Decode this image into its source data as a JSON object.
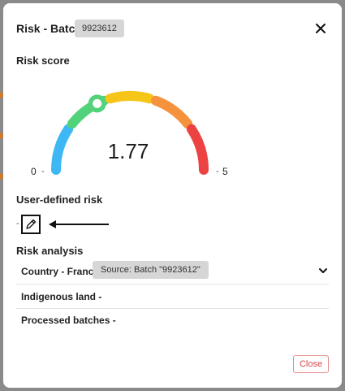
{
  "modal": {
    "title": "Risk - Batch",
    "batch_id": "9923612"
  },
  "risk_score": {
    "label": "Risk score",
    "value": "1.77",
    "value_numeric": 1.77,
    "min": "0",
    "max": "5",
    "segment_colors": [
      "#3db8f5",
      "#52d27a",
      "#f5c518",
      "#f5923e",
      "#ec4242"
    ],
    "marker_color": "#52d27a"
  },
  "user_defined_risk": {
    "label": "User-defined risk",
    "value": "-"
  },
  "risk_analysis": {
    "label": "Risk analysis",
    "rows": [
      {
        "label": "Country - France",
        "source": "Source: Batch \"9923612\""
      },
      {
        "label": "Indigenous land -"
      },
      {
        "label": "Processed batches -"
      }
    ]
  },
  "footer": {
    "close_label": "Close"
  }
}
